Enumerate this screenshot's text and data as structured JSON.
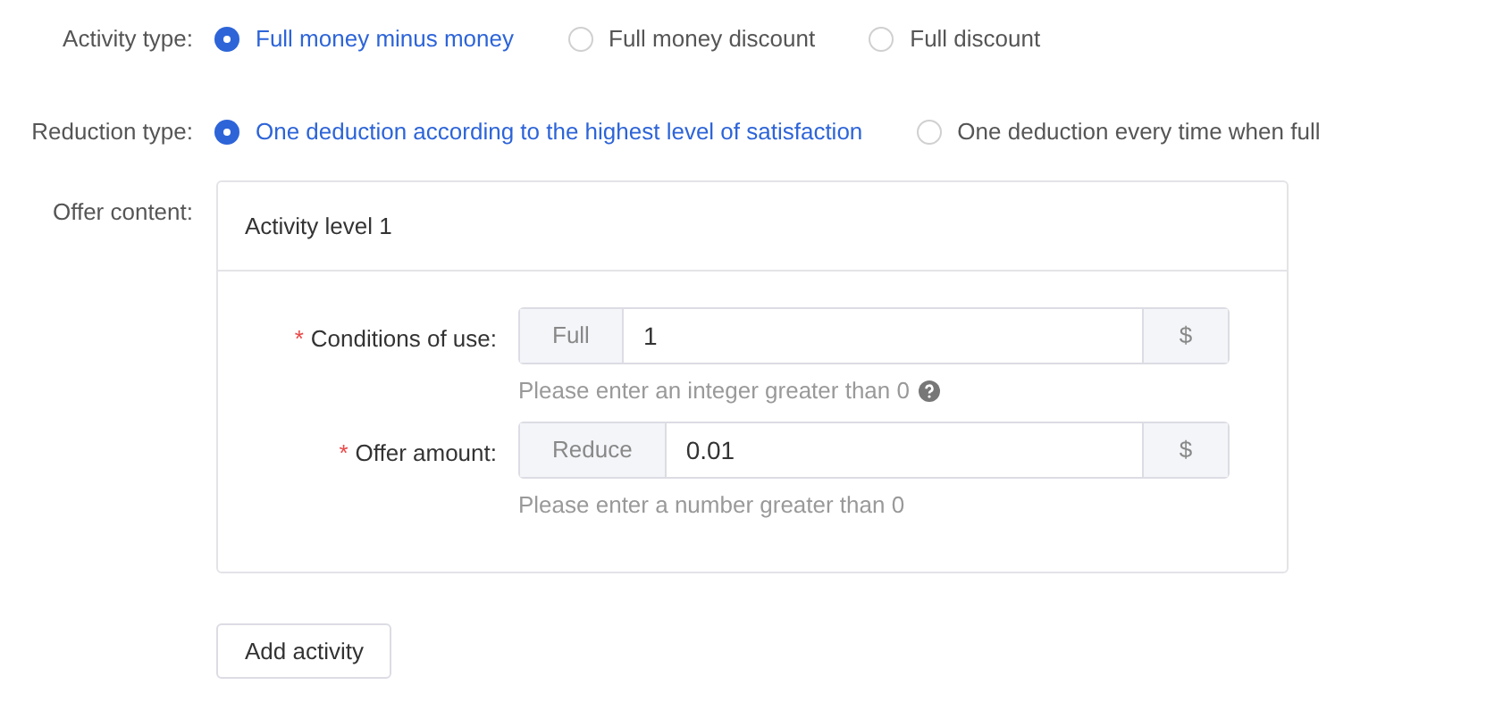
{
  "radio_groups": [
    {
      "label": "Activity type:",
      "options": [
        {
          "label": "Full money minus money",
          "selected": true
        },
        {
          "label": "Full money discount",
          "selected": false
        },
        {
          "label": "Full discount",
          "selected": false
        }
      ]
    },
    {
      "label": "Reduction type:",
      "options": [
        {
          "label": "One deduction according to the highest level of satisfaction",
          "selected": true
        },
        {
          "label": "One deduction every time when full",
          "selected": false
        }
      ]
    }
  ],
  "offer": {
    "label": "Offer content:",
    "card": {
      "title": "Activity level 1",
      "fields": [
        {
          "label": "Conditions of use:",
          "required_mark": "*",
          "prefix": "Full",
          "value": "1",
          "suffix": "$",
          "hint": "Please enter an integer greater than 0",
          "help_icon": true
        },
        {
          "label": "Offer amount:",
          "required_mark": "*",
          "prefix": "Reduce",
          "value": "0.01",
          "suffix": "$",
          "hint": "Please enter a number greater than 0",
          "help_icon": false
        }
      ]
    }
  },
  "add_button": "Add activity"
}
